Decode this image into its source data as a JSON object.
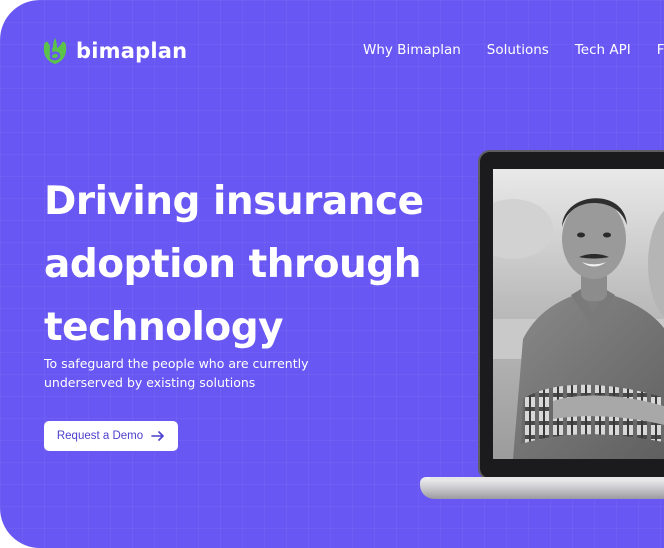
{
  "brand": {
    "name": "bimaplan",
    "logo_icon": "bimaplan-leaf-logo",
    "accent": "#6857f2",
    "logo_green": "#5cc34a"
  },
  "nav": {
    "items": [
      {
        "label": "Why Bimaplan"
      },
      {
        "label": "Solutions"
      },
      {
        "label": "Tech API"
      },
      {
        "label": "F"
      }
    ]
  },
  "hero": {
    "headline_lines": [
      "Driving insurance",
      "adoption through",
      "technology"
    ],
    "subtitle_lines": [
      "To safeguard the people who are currently",
      "underserved by existing solutions"
    ],
    "cta_label": "Request a Demo",
    "cta_icon": "arrow-right-icon",
    "image": "laptop-photo-smiling-man"
  }
}
